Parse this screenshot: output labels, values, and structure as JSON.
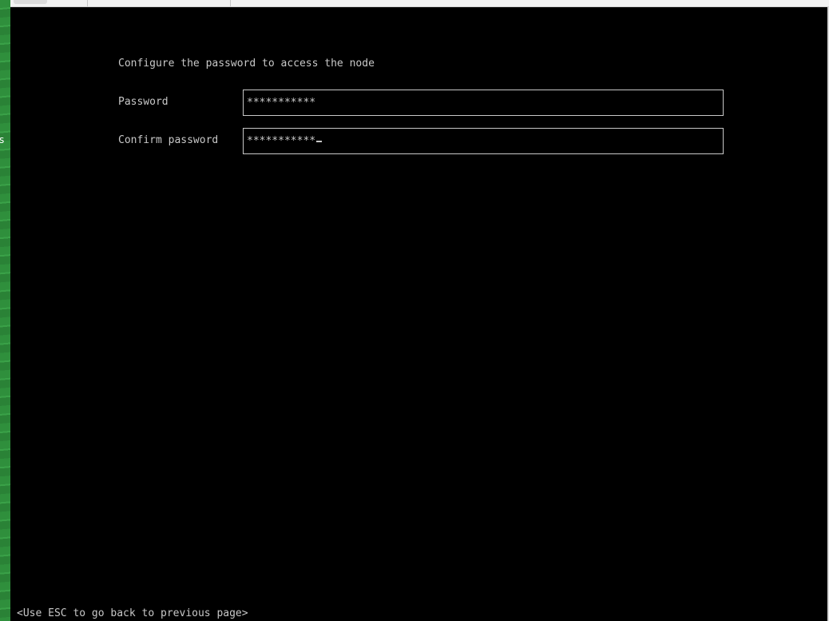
{
  "desktop": {
    "edge_text": "s"
  },
  "form": {
    "heading": "Configure the password to access the node",
    "password": {
      "label": "Password",
      "value": "***********"
    },
    "confirm_password": {
      "label": "Confirm password",
      "value": "***********"
    }
  },
  "footer": {
    "hint": "<Use ESC to go back to previous page>"
  },
  "colors": {
    "console_background": "#000000",
    "console_text": "#c8c8c8",
    "desktop_green": "#2f8f3c"
  }
}
